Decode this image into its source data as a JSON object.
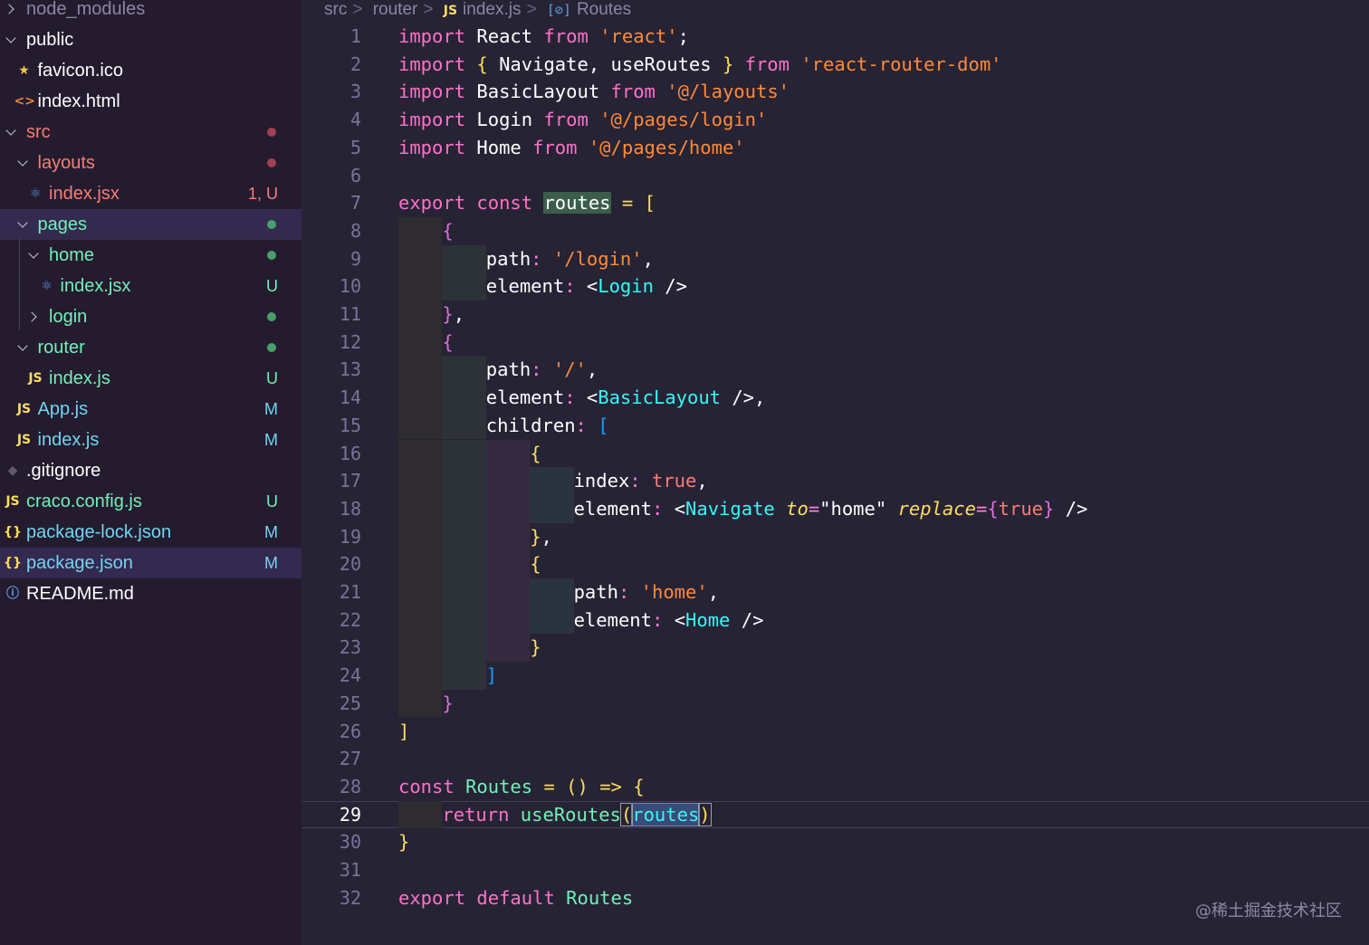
{
  "sidebar": {
    "items": [
      {
        "name": "node_modules",
        "kind": "folder",
        "expanded": false,
        "depth": 0,
        "color": "#8a86a6",
        "badge": "",
        "dot": ""
      },
      {
        "name": "public",
        "kind": "folder",
        "expanded": true,
        "depth": 0,
        "color": "#ffffff",
        "badge": "",
        "dot": ""
      },
      {
        "name": "favicon.ico",
        "kind": "file",
        "icon": "star-icon",
        "glyph": "★",
        "iconColor": "#f2c94c",
        "depth": 1,
        "color": "#ffffff",
        "badge": "",
        "dot": ""
      },
      {
        "name": "index.html",
        "kind": "file",
        "icon": "html-icon",
        "glyph": "<>",
        "iconColor": "#e8883a",
        "depth": 1,
        "color": "#ffffff",
        "badge": "",
        "dot": ""
      },
      {
        "name": "src",
        "kind": "folder",
        "expanded": true,
        "depth": 0,
        "color": "#f97e72",
        "badge": "",
        "dot": "#a04050"
      },
      {
        "name": "layouts",
        "kind": "folder",
        "expanded": true,
        "depth": 1,
        "color": "#f97e72",
        "badge": "",
        "dot": "#a04050"
      },
      {
        "name": "index.jsx",
        "kind": "file",
        "icon": "react-icon",
        "glyph": "⚛",
        "iconColor": "#5c9fe6",
        "depth": 2,
        "color": "#f97e72",
        "badge": "1, U",
        "badgeColor": "#f97e72",
        "dot": ""
      },
      {
        "name": "pages",
        "kind": "folder",
        "expanded": true,
        "depth": 1,
        "color": "#72f1b8",
        "badge": "",
        "dot": "#4a9e6b",
        "active": true
      },
      {
        "name": "home",
        "kind": "folder",
        "expanded": true,
        "depth": 2,
        "color": "#72f1b8",
        "badge": "",
        "dot": "#4a9e6b"
      },
      {
        "name": "index.jsx",
        "kind": "file",
        "icon": "react-icon",
        "glyph": "⚛",
        "iconColor": "#5c9fe6",
        "depth": 3,
        "color": "#72f1b8",
        "badge": "U",
        "badgeColor": "#72f1b8",
        "dot": ""
      },
      {
        "name": "login",
        "kind": "folder",
        "expanded": false,
        "depth": 2,
        "color": "#72f1b8",
        "badge": "",
        "dot": "#4a9e6b"
      },
      {
        "name": "router",
        "kind": "folder",
        "expanded": true,
        "depth": 1,
        "color": "#72f1b8",
        "badge": "",
        "dot": "#4a9e6b"
      },
      {
        "name": "index.js",
        "kind": "file",
        "icon": "js-icon",
        "glyph": "JS",
        "iconColor": "#fede5d",
        "depth": 2,
        "color": "#72f1b8",
        "badge": "U",
        "badgeColor": "#72f1b8",
        "dot": ""
      },
      {
        "name": "App.js",
        "kind": "file",
        "icon": "js-icon",
        "glyph": "JS",
        "iconColor": "#fede5d",
        "depth": 1,
        "color": "#72d5f1",
        "badge": "M",
        "badgeColor": "#72d5f1",
        "dot": ""
      },
      {
        "name": "index.js",
        "kind": "file",
        "icon": "js-icon",
        "glyph": "JS",
        "iconColor": "#fede5d",
        "depth": 1,
        "color": "#72d5f1",
        "badge": "M",
        "badgeColor": "#72d5f1",
        "dot": ""
      },
      {
        "name": ".gitignore",
        "kind": "file",
        "icon": "git-icon",
        "glyph": "◆",
        "iconColor": "#5e5a6e",
        "depth": 0,
        "color": "#ffffff",
        "badge": "",
        "dot": ""
      },
      {
        "name": "craco.config.js",
        "kind": "file",
        "icon": "js-icon",
        "glyph": "JS",
        "iconColor": "#fede5d",
        "depth": 0,
        "color": "#72f1b8",
        "badge": "U",
        "badgeColor": "#72f1b8",
        "dot": ""
      },
      {
        "name": "package-lock.json",
        "kind": "file",
        "icon": "json-icon",
        "glyph": "{}",
        "iconColor": "#fede5d",
        "depth": 0,
        "color": "#72d5f1",
        "badge": "M",
        "badgeColor": "#72d5f1",
        "dot": ""
      },
      {
        "name": "package.json",
        "kind": "file",
        "icon": "json-icon",
        "glyph": "{}",
        "iconColor": "#fede5d",
        "depth": 0,
        "color": "#72d5f1",
        "badge": "M",
        "badgeColor": "#72d5f1",
        "dot": "",
        "active": true
      },
      {
        "name": "README.md",
        "kind": "file",
        "icon": "info-icon",
        "glyph": "ⓘ",
        "iconColor": "#5c9fe6",
        "depth": 0,
        "color": "#ffffff",
        "badge": "",
        "dot": ""
      }
    ]
  },
  "breadcrumb": {
    "src": "src",
    "router": "router",
    "js_tag": "JS",
    "file": "index.js",
    "symbol_icon": "[⊘]",
    "symbol": "Routes"
  },
  "editor": {
    "current_line": 29,
    "lines": [
      {
        "n": "1",
        "ind": 0,
        "t": [
          [
            "kwp",
            "import"
          ],
          [
            "tx",
            " React "
          ],
          [
            "kwp",
            "from"
          ],
          [
            "tx",
            " "
          ],
          [
            "st",
            "'react'"
          ],
          [
            "tx",
            ";"
          ]
        ]
      },
      {
        "n": "2",
        "ind": 0,
        "t": [
          [
            "kwp",
            "import"
          ],
          [
            "tx",
            " "
          ],
          [
            "br1",
            "{"
          ],
          [
            "tx",
            " Navigate, useRoutes "
          ],
          [
            "br1",
            "}"
          ],
          [
            "tx",
            " "
          ],
          [
            "kwp",
            "from"
          ],
          [
            "tx",
            " "
          ],
          [
            "st",
            "'react-router-dom'"
          ]
        ]
      },
      {
        "n": "3",
        "ind": 0,
        "t": [
          [
            "kwp",
            "import"
          ],
          [
            "tx",
            " BasicLayout "
          ],
          [
            "kwp",
            "from"
          ],
          [
            "tx",
            " "
          ],
          [
            "st",
            "'@/layouts'"
          ]
        ]
      },
      {
        "n": "4",
        "ind": 0,
        "t": [
          [
            "kwp",
            "import"
          ],
          [
            "tx",
            " Login "
          ],
          [
            "kwp",
            "from"
          ],
          [
            "tx",
            " "
          ],
          [
            "st",
            "'@/pages/login'"
          ]
        ]
      },
      {
        "n": "5",
        "ind": 0,
        "t": [
          [
            "kwp",
            "import"
          ],
          [
            "tx",
            " Home "
          ],
          [
            "kwp",
            "from"
          ],
          [
            "tx",
            " "
          ],
          [
            "st",
            "'@/pages/home'"
          ]
        ]
      },
      {
        "n": "6",
        "ind": 0,
        "t": []
      },
      {
        "n": "7",
        "ind": 0,
        "t": [
          [
            "kwp",
            "export"
          ],
          [
            "tx",
            " "
          ],
          [
            "kwp",
            "const"
          ],
          [
            "tx",
            " "
          ],
          [
            "hl",
            "routes"
          ],
          [
            "tx",
            " "
          ],
          [
            "op",
            "="
          ],
          [
            "tx",
            " "
          ],
          [
            "br1",
            "["
          ]
        ]
      },
      {
        "n": "8",
        "ind": 1,
        "t": [
          [
            "br2",
            "{"
          ]
        ]
      },
      {
        "n": "9",
        "ind": 2,
        "t": [
          [
            "tx",
            "path"
          ],
          [
            "pk",
            ":"
          ],
          [
            "tx",
            " "
          ],
          [
            "st",
            "'/login'"
          ],
          [
            "tx",
            ","
          ]
        ]
      },
      {
        "n": "10",
        "ind": 2,
        "t": [
          [
            "tx",
            "element"
          ],
          [
            "pk",
            ":"
          ],
          [
            "tx",
            " "
          ],
          [
            "tx",
            "<"
          ],
          [
            "fn",
            "Login"
          ],
          [
            "tx",
            " />"
          ]
        ]
      },
      {
        "n": "11",
        "ind": 1,
        "t": [
          [
            "br2",
            "}"
          ],
          [
            "tx",
            ","
          ]
        ]
      },
      {
        "n": "12",
        "ind": 1,
        "t": [
          [
            "br2",
            "{"
          ]
        ]
      },
      {
        "n": "13",
        "ind": 2,
        "t": [
          [
            "tx",
            "path"
          ],
          [
            "pk",
            ":"
          ],
          [
            "tx",
            " "
          ],
          [
            "st",
            "'/'"
          ],
          [
            "tx",
            ","
          ]
        ]
      },
      {
        "n": "14",
        "ind": 2,
        "t": [
          [
            "tx",
            "element"
          ],
          [
            "pk",
            ":"
          ],
          [
            "tx",
            " "
          ],
          [
            "tx",
            "<"
          ],
          [
            "fn",
            "BasicLayout"
          ],
          [
            "tx",
            " />,"
          ]
        ]
      },
      {
        "n": "15",
        "ind": 2,
        "t": [
          [
            "tx",
            "children"
          ],
          [
            "pk",
            ":"
          ],
          [
            "tx",
            " "
          ],
          [
            "br3",
            "["
          ]
        ]
      },
      {
        "n": "16",
        "ind": 3,
        "t": [
          [
            "br1",
            "{"
          ]
        ]
      },
      {
        "n": "17",
        "ind": 4,
        "t": [
          [
            "tx",
            "index"
          ],
          [
            "pk",
            ":"
          ],
          [
            "tx",
            " "
          ],
          [
            "bool",
            "true"
          ],
          [
            "tx",
            ","
          ]
        ]
      },
      {
        "n": "18",
        "ind": 4,
        "t": [
          [
            "tx",
            "element"
          ],
          [
            "pk",
            ":"
          ],
          [
            "tx",
            " "
          ],
          [
            "tx",
            "<"
          ],
          [
            "fn",
            "Navigate"
          ],
          [
            "tx",
            " "
          ],
          [
            "attr",
            "to"
          ],
          [
            "pk",
            "="
          ],
          [
            "tx",
            "\"home\""
          ],
          [
            "tx",
            " "
          ],
          [
            "attr",
            "replace"
          ],
          [
            "pk",
            "="
          ],
          [
            "br2",
            "{"
          ],
          [
            "bool",
            "true"
          ],
          [
            "br2",
            "}"
          ],
          [
            "tx",
            " />"
          ]
        ]
      },
      {
        "n": "19",
        "ind": 3,
        "t": [
          [
            "br1",
            "}"
          ],
          [
            "tx",
            ","
          ]
        ]
      },
      {
        "n": "20",
        "ind": 3,
        "t": [
          [
            "br1",
            "{"
          ]
        ]
      },
      {
        "n": "21",
        "ind": 4,
        "t": [
          [
            "tx",
            "path"
          ],
          [
            "pk",
            ":"
          ],
          [
            "tx",
            " "
          ],
          [
            "st",
            "'home'"
          ],
          [
            "tx",
            ","
          ]
        ]
      },
      {
        "n": "22",
        "ind": 4,
        "t": [
          [
            "tx",
            "element"
          ],
          [
            "pk",
            ":"
          ],
          [
            "tx",
            " "
          ],
          [
            "tx",
            "<"
          ],
          [
            "fn",
            "Home"
          ],
          [
            "tx",
            " />"
          ]
        ]
      },
      {
        "n": "23",
        "ind": 3,
        "t": [
          [
            "br1",
            "}"
          ]
        ]
      },
      {
        "n": "24",
        "ind": 2,
        "t": [
          [
            "br3",
            "]"
          ]
        ]
      },
      {
        "n": "25",
        "ind": 1,
        "t": [
          [
            "br2",
            "}"
          ]
        ]
      },
      {
        "n": "26",
        "ind": 0,
        "t": [
          [
            "br1",
            "]"
          ]
        ]
      },
      {
        "n": "27",
        "ind": 0,
        "t": []
      },
      {
        "n": "28",
        "ind": 0,
        "t": [
          [
            "kwp",
            "const"
          ],
          [
            "tx",
            " "
          ],
          [
            "gr",
            "Routes"
          ],
          [
            "tx",
            " "
          ],
          [
            "op",
            "="
          ],
          [
            "tx",
            " "
          ],
          [
            "br1",
            "()"
          ],
          [
            "tx",
            " "
          ],
          [
            "op",
            "=>"
          ],
          [
            "tx",
            " "
          ],
          [
            "br1",
            "{"
          ]
        ]
      },
      {
        "n": "29",
        "ind": 1,
        "t": [
          [
            "kwp",
            "return"
          ],
          [
            "tx",
            " "
          ],
          [
            "gr",
            "useRoutes"
          ],
          [
            "paren",
            "("
          ],
          [
            "sel",
            "routes"
          ],
          [
            "paren",
            ")"
          ]
        ]
      },
      {
        "n": "30",
        "ind": 0,
        "t": [
          [
            "br1",
            "}"
          ]
        ]
      },
      {
        "n": "31",
        "ind": 0,
        "t": []
      },
      {
        "n": "32",
        "ind": 0,
        "t": [
          [
            "kwp",
            "export"
          ],
          [
            "tx",
            " "
          ],
          [
            "kwp",
            "default"
          ],
          [
            "tx",
            " "
          ],
          [
            "gr",
            "Routes"
          ]
        ]
      }
    ]
  },
  "watermark": "@稀土掘金技术社区"
}
